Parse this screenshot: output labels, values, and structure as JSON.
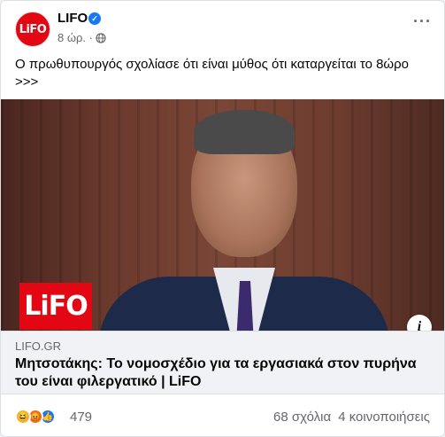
{
  "header": {
    "page_name": "LIFO",
    "avatar_text": "LiFO",
    "time": "8 ώρ. ·",
    "more": "···"
  },
  "post": {
    "text": "Ο πρωθυπουργός σχολίασε ότι είναι μύθος ότι καταργείται το 8ώρο >>>"
  },
  "image": {
    "logo_text": "LiFO",
    "info": "i"
  },
  "link": {
    "domain": "LIFO.GR",
    "title": "Μητσοτάκης: Το νομοσχέδιο για τα εργασιακά στον πυρήνα του είναι φιλεργατικό | LiFO"
  },
  "footer": {
    "reaction_count": "479",
    "comments": "68 σχόλια",
    "shares": "4 κοινοποιήσεις"
  },
  "colors": {
    "brand": "#e30613",
    "verified": "#1877f2"
  }
}
